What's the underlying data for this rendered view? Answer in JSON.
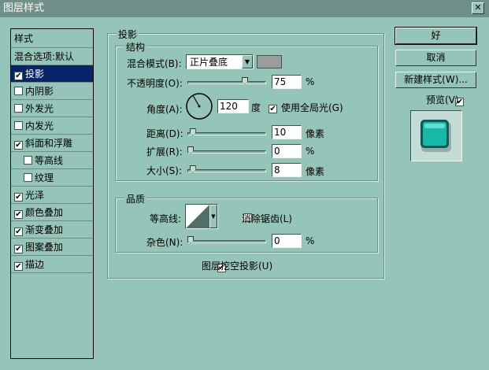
{
  "window": {
    "title": "图层样式",
    "close_glyph": "✕"
  },
  "left_panel": {
    "header": "样式",
    "items": [
      {
        "label": "混合选项:默认",
        "checkbox": false,
        "checked": false,
        "indent": false,
        "selected": false
      },
      {
        "label": "投影",
        "checkbox": true,
        "checked": true,
        "indent": false,
        "selected": true
      },
      {
        "label": "内阴影",
        "checkbox": true,
        "checked": false,
        "indent": false,
        "selected": false
      },
      {
        "label": "外发光",
        "checkbox": true,
        "checked": false,
        "indent": false,
        "selected": false
      },
      {
        "label": "内发光",
        "checkbox": true,
        "checked": false,
        "indent": false,
        "selected": false
      },
      {
        "label": "斜面和浮雕",
        "checkbox": true,
        "checked": true,
        "indent": false,
        "selected": false
      },
      {
        "label": "等高线",
        "checkbox": true,
        "checked": false,
        "indent": true,
        "selected": false
      },
      {
        "label": "纹理",
        "checkbox": true,
        "checked": false,
        "indent": true,
        "selected": false
      },
      {
        "label": "光泽",
        "checkbox": true,
        "checked": true,
        "indent": false,
        "selected": false
      },
      {
        "label": "颜色叠加",
        "checkbox": true,
        "checked": true,
        "indent": false,
        "selected": false
      },
      {
        "label": "渐变叠加",
        "checkbox": true,
        "checked": true,
        "indent": false,
        "selected": false
      },
      {
        "label": "图案叠加",
        "checkbox": true,
        "checked": true,
        "indent": false,
        "selected": false
      },
      {
        "label": "描边",
        "checkbox": true,
        "checked": true,
        "indent": false,
        "selected": false
      }
    ]
  },
  "drop_shadow": {
    "title": "投影",
    "structure": {
      "title": "结构",
      "blend_mode_label": "混合模式(B):",
      "blend_mode_value": "正片叠底",
      "blend_color": "#9c9c9c",
      "opacity_label": "不透明度(O):",
      "opacity_value": "75",
      "opacity_unit": "%",
      "opacity_fraction": 0.75,
      "angle_label": "角度(A):",
      "angle_value": "120",
      "angle_unit": "度",
      "global_light_label": "使用全局光(G)",
      "global_light_checked": true,
      "distance_label": "距离(D):",
      "distance_value": "10",
      "distance_unit": "像素",
      "distance_fraction": 0.03,
      "spread_label": "扩展(R):",
      "spread_value": "0",
      "spread_unit": "%",
      "spread_fraction": 0.0,
      "size_label": "大小(S):",
      "size_value": "8",
      "size_unit": "像素",
      "size_fraction": 0.03
    },
    "quality": {
      "title": "品质",
      "contour_label": "等高线:",
      "anti_alias_label": "消除锯齿(L)",
      "anti_alias_checked": false,
      "noise_label": "杂色(N):",
      "noise_value": "0",
      "noise_unit": "%",
      "noise_fraction": 0.0
    },
    "knockout_label": "图层挖空投影(U)",
    "knockout_checked": true
  },
  "buttons": {
    "ok": "好",
    "cancel": "取消",
    "new_style": "新建样式(W)...",
    "preview_label": "预览(V)",
    "preview_checked": true
  },
  "colors": {
    "dialog_bg": "#95c4b8",
    "title_bg": "#6f8f88",
    "selected_bg": "#0a246a",
    "preview_swatch": "#16b8a8"
  }
}
